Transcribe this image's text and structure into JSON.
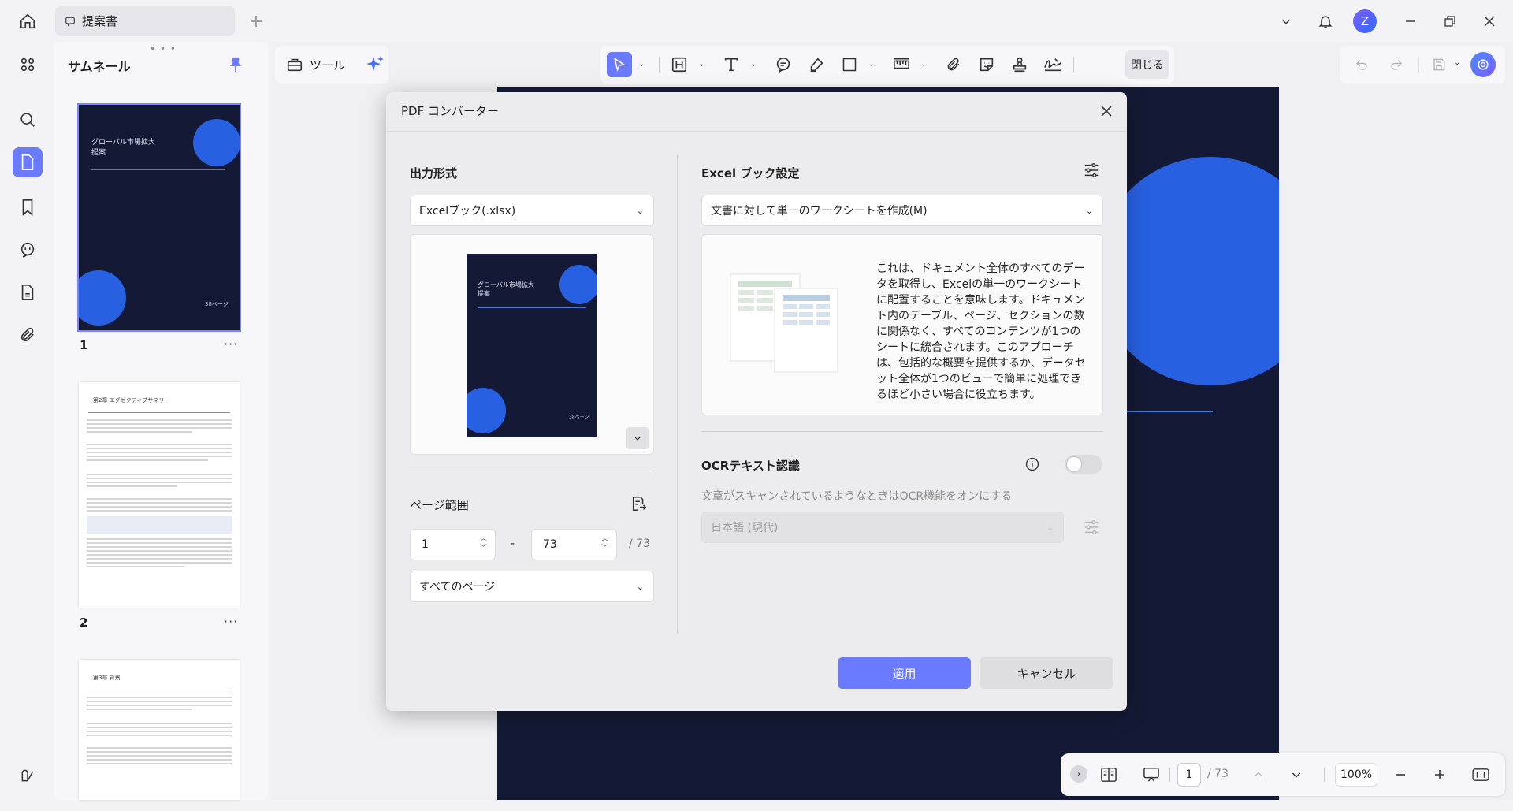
{
  "tab": {
    "title": "提案書"
  },
  "user": {
    "initial": "Z"
  },
  "thumbnails": {
    "title": "サムネール",
    "pages": [
      {
        "number": "1",
        "title_line1": "グローバル市場拡大",
        "title_line2": "提案",
        "footer": "38ページ"
      },
      {
        "number": "2",
        "heading": "第2章 エグゼクティブサマリー"
      },
      {
        "number": "",
        "heading": "第3章 背景"
      }
    ]
  },
  "toolbar": {
    "tools_label": "ツール",
    "close_label": "閉じる"
  },
  "bottombar": {
    "current_page": "1",
    "total_pages": "/ 73",
    "zoom": "100%"
  },
  "dialog": {
    "title": "PDF コンバーター",
    "output_format": {
      "label": "出力形式",
      "value": "Excelブック(.xlsx)"
    },
    "preview": {
      "title_line1": "グローバル市場拡大",
      "title_line2": "提案",
      "footer": "38ページ"
    },
    "page_range": {
      "label": "ページ範囲",
      "from": "1",
      "separator": "-",
      "to": "73",
      "total": "/ 73",
      "subset": "すべてのページ"
    },
    "excel_settings": {
      "label": "Excel ブック設定",
      "mode": "文書に対して単一のワークシートを作成(M)",
      "description": "これは、ドキュメント全体のすべてのデータを取得し、Excelの単一のワークシートに配置することを意味します。ドキュメント内のテーブル、ページ、セクションの数に関係なく、すべてのコンテンツが1つのシートに統合されます。このアプローチは、包括的な概要を提供するか、データセット全体が1つのビューで簡単に処理できるほど小さい場合に役立ちます。"
    },
    "ocr": {
      "label": "OCRテキスト認識",
      "hint": "文章がスキャンされているようなときはOCR機能をオンにする",
      "language": "日本語 (現代)",
      "enabled": false
    },
    "apply_label": "適用",
    "cancel_label": "キャンセル"
  },
  "colors": {
    "accent": "#6b7bff",
    "doc_bg": "#141a35",
    "doc_circle": "#2760e0"
  }
}
